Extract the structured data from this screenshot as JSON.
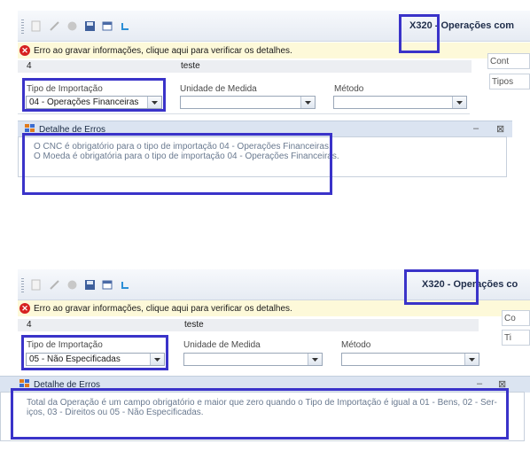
{
  "toolbar_icons": [
    "new-icon",
    "edit-icon",
    "delete-icon",
    "save-icon",
    "window-icon",
    "refresh-icon"
  ],
  "panels": [
    {
      "title": "X320 - Operações com",
      "error_bar": "Erro ao gravar informações, clique aqui para verificar os detalhes.",
      "row": {
        "code": "4",
        "desc": "teste"
      },
      "side_tabs": [
        "Cont",
        "Tipos"
      ],
      "labels": {
        "tipo": "Tipo de Importação",
        "unidade": "Unidade de Medida",
        "metodo": "Método"
      },
      "tipo_value": "04 - Operações Financeiras",
      "dialog_title": "Detalhe de Erros",
      "dialog_min": "‒",
      "dialog_close": "⊠",
      "messages": [
        "O CNC é obrigatório para o tipo de importação 04 - Operações Financeiras.",
        "O Moeda é obrigatória para o tipo de importação 04 - Operações Financeiras."
      ]
    },
    {
      "title": "X320 - Operações co",
      "error_bar": "Erro ao gravar informações, clique aqui para verificar os detalhes.",
      "row": {
        "code": "4",
        "desc": "teste"
      },
      "side_tabs": [
        "Co",
        "Ti"
      ],
      "labels": {
        "tipo": "Tipo de Importação",
        "unidade": "Unidade de Medida",
        "metodo": "Método"
      },
      "tipo_value": "05 - Não Especificadas",
      "dialog_title": "Detalhe de Erros",
      "dialog_min": "‒",
      "dialog_close": "⊠",
      "messages": [
        "Total da Operação é um campo obrigatório e maior que zero quando o Tipo de Importação é igual a 01 - Bens, 02 - Ser-",
        "iços, 03 - Direitos ou 05 - Não Especificadas."
      ]
    }
  ],
  "colors": {
    "highlight": "#3a33c9",
    "error_bar_bg": "#fdf9d9",
    "dialog_head": "#dbe4f1"
  }
}
